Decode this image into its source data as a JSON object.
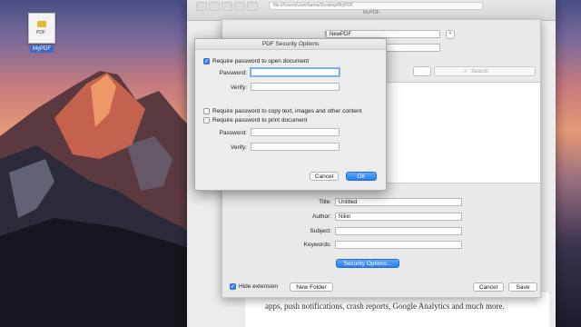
{
  "desktop": {
    "file_icon": {
      "name": "MyPDF",
      "type": "PDF"
    }
  },
  "background_window": {
    "path": "file:///Users/UserName/Desktop/MyPDF",
    "title": "MyPDF"
  },
  "save_dialog": {
    "save_as_label": "Save As:",
    "save_as_value": "NewPDF",
    "search_placeholder": "Search",
    "title_label": "Title:",
    "title_value": "Untitled",
    "author_label": "Author:",
    "author_value": "Nikin",
    "subject_label": "Subject:",
    "subject_value": "",
    "keywords_label": "Keywords:",
    "keywords_value": "",
    "security_button": "Security Options...",
    "hide_extension_label": "Hide extension",
    "hide_extension_checked": true,
    "new_folder_button": "New Folder",
    "cancel_button": "Cancel",
    "save_button": "Save"
  },
  "security_dialog": {
    "title": "PDF Security Options",
    "open_doc_label": "Require password to open document",
    "open_doc_checked": true,
    "password_label": "Password:",
    "password_value": "",
    "verify_label": "Verify:",
    "verify_value": "",
    "copy_label": "Require password to copy text, images and other content",
    "copy_checked": false,
    "print_label": "Require password to print document",
    "print_checked": false,
    "password2_label": "Password:",
    "verify2_label": "Verify:",
    "cancel_button": "Cancel",
    "ok_button": "OK"
  },
  "document_text": {
    "line1": "apps, push notifications, crash reports, Google Analytics and much more."
  },
  "colors": {
    "accent": "#2a7cf0",
    "checkbox_on": "#3b86f2"
  }
}
